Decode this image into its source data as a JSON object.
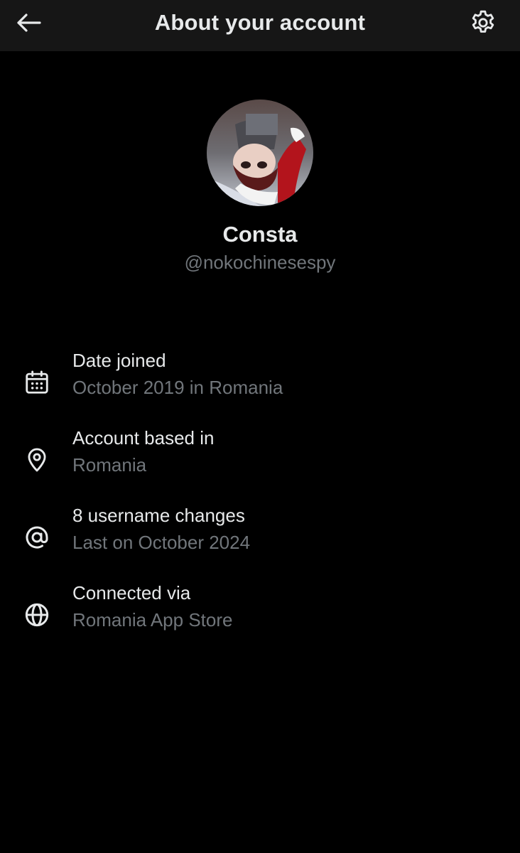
{
  "header": {
    "title": "About your account",
    "back_icon": "arrow-left-icon",
    "settings_icon": "gear-icon"
  },
  "profile": {
    "display_name": "Consta",
    "handle": "@nokochinesespy"
  },
  "info": [
    {
      "icon": "calendar-icon",
      "label": "Date joined",
      "value": "October 2019 in Romania"
    },
    {
      "icon": "location-pin-icon",
      "label": "Account based in",
      "value": "Romania"
    },
    {
      "icon": "at-sign-icon",
      "label": "8 username changes",
      "value": "Last on October 2024"
    },
    {
      "icon": "globe-icon",
      "label": "Connected via",
      "value": "Romania App Store"
    }
  ],
  "colors": {
    "background": "#000000",
    "header_bg": "#161616",
    "primary_text": "#e7e9ea",
    "secondary_text": "#71767b"
  }
}
